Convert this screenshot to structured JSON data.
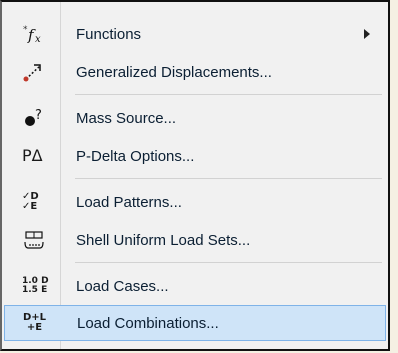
{
  "menu": {
    "items": [
      {
        "label": "Functions",
        "icon": "fx-icon",
        "submenu": true
      },
      {
        "label": "Generalized Displacements...",
        "icon": "displacement-icon"
      },
      {
        "label": "Mass Source...",
        "icon": "mass-source-icon"
      },
      {
        "label": "P-Delta Options...",
        "icon": "p-delta-icon"
      },
      {
        "label": "Load Patterns...",
        "icon": "load-patterns-icon"
      },
      {
        "label": "Shell Uniform Load Sets...",
        "icon": "shell-load-icon"
      },
      {
        "label": "Load Cases...",
        "icon": "load-cases-icon"
      },
      {
        "label": "Load Combinations...",
        "icon": "load-combinations-icon"
      }
    ],
    "icon_text": {
      "p_delta": "PΔ",
      "load_patterns_top": "✓D",
      "load_patterns_bottom": "✓E",
      "load_cases_top": "1.0 D",
      "load_cases_bottom": "1.5 E",
      "combo_top": "D+L",
      "combo_bottom": "+E"
    },
    "highlight_color": "#cfe4f8"
  }
}
